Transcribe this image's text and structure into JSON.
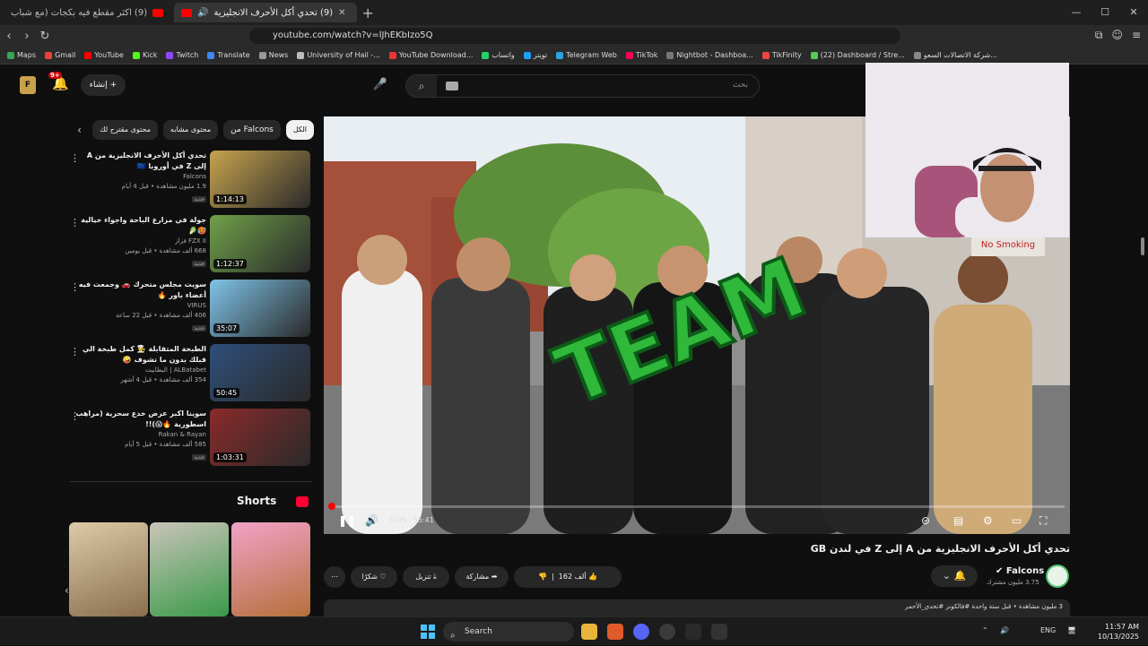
{
  "browser": {
    "tabs": [
      {
        "title": "(9) اكثر مقطع فيه بكجات (مع شباب",
        "active": false
      },
      {
        "title": "(9) تحدي أكل الأحرف الانجليزية",
        "active": true
      }
    ],
    "url": "youtube.com/watch?v=lJhEKbIzo5Q",
    "bookmarks": [
      "Maps",
      "Gmail",
      "YouTube",
      "Kick",
      "Twitch",
      "Translate",
      "News",
      "University of Hail -...",
      "YouTube Download...",
      "واتساب",
      "تويتر",
      "Telegram Web",
      "TikTok",
      "Nightbot - Dashboa...",
      "TikFinity",
      "(22) Dashboard / Stre...",
      "شركة الاتصالات السعو..."
    ]
  },
  "header": {
    "notifications": "9+",
    "create_label": "إنشاء",
    "search_placeholder": "بحث"
  },
  "chips": [
    {
      "label": "الكل",
      "selected": true
    },
    {
      "label": "من Falcons",
      "selected": false
    },
    {
      "label": "محتوى مشابه",
      "selected": false
    },
    {
      "label": "محتوى مقترح لك",
      "selected": false
    }
  ],
  "related": [
    {
      "title": "تحدي أكل الأحرف الانجليزية من A إلى Z في أوروبا 🇪🇺",
      "channel": "Falcons",
      "stats": "1.9 مليون مشاهدة • قبل 4 أيام",
      "badge": "جديد",
      "duration": "1:14:13",
      "thumb": "#c7a34e"
    },
    {
      "title": "جولة في مزارع الباحة واجواء خيالية 🥵🥬",
      "channel": "FZX II فزاز",
      "stats": "668 ألف مشاهدة • قبل يومين",
      "badge": "جديد",
      "duration": "1:12:37",
      "thumb": "#6fa14a"
    },
    {
      "title": "سويت مجلس متحرك 🚗 وجمعت فيه أعضاء باور 🔥",
      "channel": "VIRUS",
      "stats": "406 ألف مشاهدة • قبل 22 ساعة",
      "badge": "جديد",
      "duration": "35:07",
      "thumb": "#7fc3e8"
    },
    {
      "title": "الطبخة المتقابلة 👨‍🍳 كمل طبخة الي قبلك بدون ما تشوف 🤪",
      "channel": "ALBatabet | البطابيت",
      "stats": "354 ألف مشاهدة • قبل 4 أشهر",
      "badge": "",
      "duration": "50:45",
      "thumb": "#2e4f7a"
    },
    {
      "title": "سوينا اكبر عرض خدع سحرية (مراهب اسطورية 🔥😱)!!",
      "channel": "Rakan & Rayan",
      "stats": "585 ألف مشاهدة • قبل 5 أيام",
      "badge": "جديد",
      "duration": "1:03:31",
      "thumb": "#8a2a2a"
    }
  ],
  "shorts": {
    "heading": "Shorts",
    "items": [
      {
        "thumb": "#c9b08a"
      },
      {
        "thumb": "#4a8c5a"
      },
      {
        "thumb": "#d06aa0"
      }
    ]
  },
  "player": {
    "current_time": "0:05",
    "duration": "55:41",
    "progress": 0.0015,
    "overlay_text": "TEAM",
    "sign_text": "No Smoking"
  },
  "video": {
    "title": "تحدي أكل الأحرف الانجليزية من A إلى Z في لندن GB",
    "channel": "Falcons",
    "subscribers": "3.75 مليون مشترك",
    "likes": "162 ألف",
    "share_label": "مشاركة",
    "download_label": "تنزيل",
    "thanks_label": "شكرًا",
    "description": "3 مليون مشاهدة • قبل ستة واحدة #فالكونز #تحدي_الأحمر"
  },
  "taskbar": {
    "search_label": "Search",
    "language": "ENG",
    "time": "11:57 AM",
    "date": "10/13/2025"
  }
}
